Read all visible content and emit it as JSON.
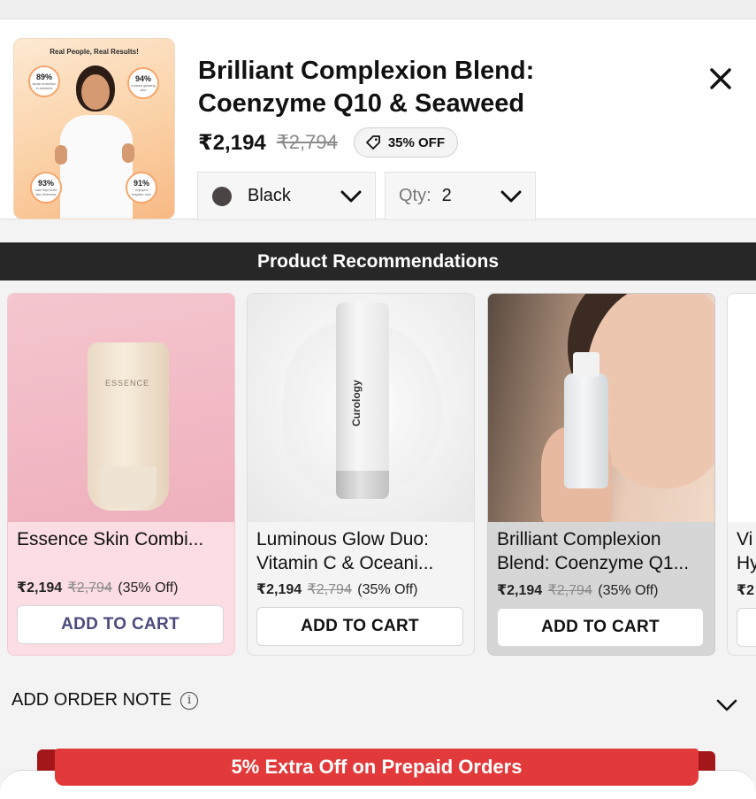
{
  "cart_item": {
    "thumbnail": {
      "headline": "Real People, Real Results!",
      "stats": [
        {
          "value": "89%",
          "caption": "facial reduction in wrinkles"
        },
        {
          "value": "94%",
          "caption": "noticed glowing skin"
        },
        {
          "value": "93%",
          "caption": "saw improved skin firmness"
        },
        {
          "value": "91%",
          "caption": "enjoyed brighter skin"
        }
      ]
    },
    "title_line1": "Brilliant Complexion Blend:",
    "title_line2": "Coenzyme Q10 & Seaweed",
    "price": "₹2,194",
    "compare_price": "₹2,794",
    "discount_badge": "35% OFF",
    "variant": {
      "label": "Black",
      "swatch_color": "#4a4544"
    },
    "quantity": {
      "label": "Qty:",
      "value": "2"
    },
    "close_icon": "close-icon"
  },
  "recommendations": {
    "heading": "Product Recommendations",
    "items": [
      {
        "name_line1": "Essence Skin Combi...",
        "name_line2": "",
        "price": "₹2,194",
        "compare_price": "₹2,794",
        "discount": "(35% Off)",
        "button": "ADD TO CART",
        "image_label": "ESSENCE"
      },
      {
        "name_line1": "Luminous Glow Duo:",
        "name_line2": "Vitamin C & Oceani...",
        "price": "₹2,194",
        "compare_price": "₹2,794",
        "discount": "(35% Off)",
        "button": "ADD TO CART",
        "image_label": "Curology"
      },
      {
        "name_line1": "Brilliant Complexion",
        "name_line2": "Blend: Coenzyme Q1...",
        "price": "₹2,194",
        "compare_price": "₹2,794",
        "discount": "(35% Off)",
        "button": "ADD TO CART",
        "image_label": ""
      },
      {
        "name_line1": "Vi",
        "name_line2": "Hy",
        "price": "₹2",
        "compare_price": "",
        "discount": "",
        "button": "",
        "image_label": ""
      }
    ]
  },
  "order_note": {
    "label": "ADD ORDER NOTE",
    "info_icon": "i"
  },
  "promo": {
    "text": "5% Extra Off on Prepaid Orders",
    "color": "#e23a3a"
  }
}
